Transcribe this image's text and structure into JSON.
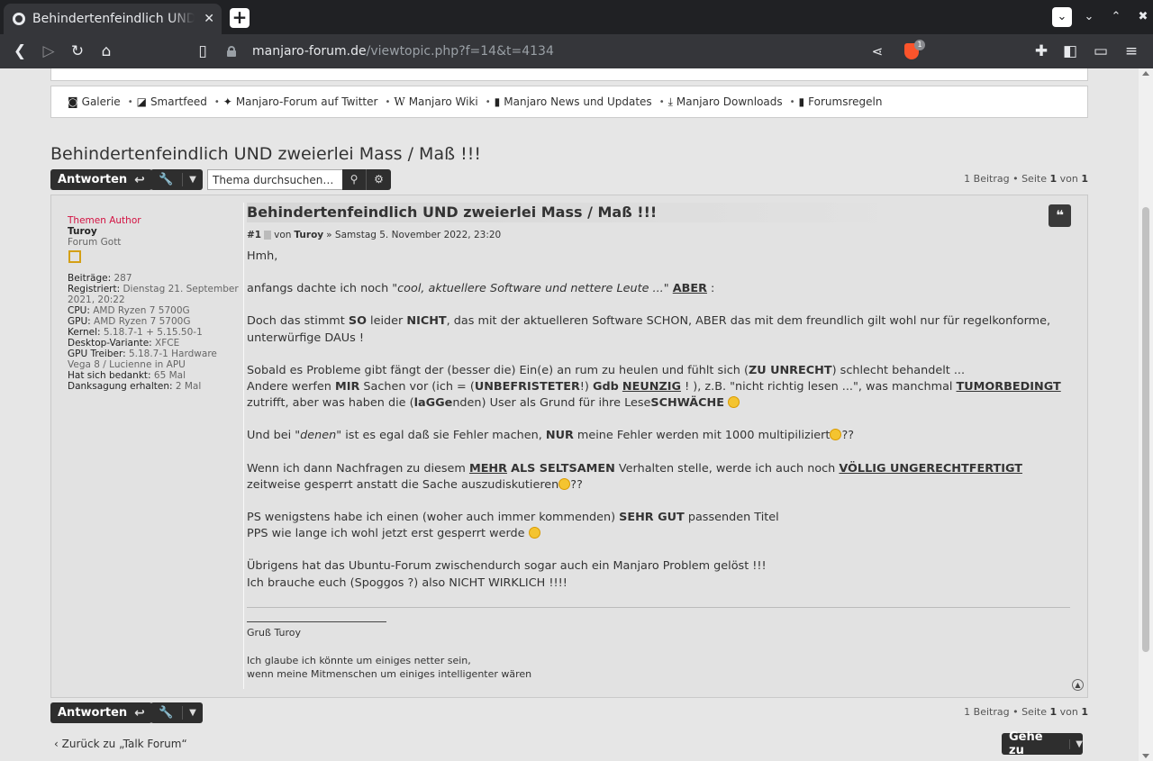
{
  "browser": {
    "tab_title": "Behindertenfeindlich UND zweierlei Mass / Maß !!!",
    "url_host": "manjaro-forum.de",
    "url_path": "/viewtopic.php?f=14&t=4134",
    "shield_count": "1"
  },
  "quicklinks": [
    {
      "icon": "camera-icon",
      "label": "Galerie"
    },
    {
      "icon": "rss-icon",
      "label": "Smartfeed"
    },
    {
      "icon": "twitter-icon",
      "label": "Manjaro-Forum auf Twitter"
    },
    {
      "icon": "wikipedia-icon",
      "label": "Manjaro Wiki"
    },
    {
      "icon": "book-icon",
      "label": "Manjaro News und Updates"
    },
    {
      "icon": "download-icon",
      "label": "Manjaro Downloads"
    },
    {
      "icon": "book-icon",
      "label": "Forumsregeln"
    }
  ],
  "topic": {
    "title": "Behindertenfeindlich UND zweierlei Mass / Maß !!!",
    "reply_label": "Antworten",
    "search_placeholder": "Thema durchsuchen…",
    "pagination": {
      "pre": "1 Beitrag • Seite ",
      "page": "1",
      "mid": " von ",
      "total": "1"
    }
  },
  "post": {
    "title": "Behindertenfeindlich UND zweierlei Mass / Maß !!!",
    "number": "#1",
    "by": "von",
    "author": "Turoy",
    "date": "» Samstag 5. November 2022, 23:20"
  },
  "profile": {
    "rank": "Themen Author",
    "name": "Turoy",
    "title": "Forum Gott",
    "fields": [
      {
        "k": "Beiträge:",
        "v": " 287"
      },
      {
        "k": "Registriert:",
        "v": " Dienstag 21. September 2021, 20:22"
      },
      {
        "k": "CPU:",
        "v": " AMD Ryzen 7 5700G"
      },
      {
        "k": "GPU:",
        "v": " AMD Ryzen 7 5700G"
      },
      {
        "k": "Kernel:",
        "v": " 5.18.7-1 + 5.15.50-1"
      },
      {
        "k": "Desktop-Variante:",
        "v": " XFCE"
      },
      {
        "k": "GPU Treiber:",
        "v": " 5.18.7-1 Hardware Vega 8 / Lucienne in APU"
      },
      {
        "k": "Hat sich bedankt:",
        "v": " 65 Mal"
      },
      {
        "k": "Danksagung erhalten:",
        "v": " 2 Mal"
      }
    ]
  },
  "content": {
    "p1": "Hmh,",
    "p2a": "anfangs dachte ich noch ",
    "p2b": "\"cool, aktuellere Software und nettere Leute ...\"",
    "p2c": " ",
    "p2d": "ABER",
    "p2e": " :",
    "p3a": "Doch das stimmt ",
    "p3b": "SO",
    "p3c": " leider ",
    "p3d": "NICHT",
    "p3e": ", das mit der aktuelleren Software SCHON, ABER das mit dem freundlich gilt wohl nur für regelkonforme, unterwürfige DAUs !",
    "p4a": "Sobald es Probleme gibt fängt der (besser die) Ein(e) an rum zu heulen und fühlt sich (",
    "p4b": "ZU UNRECHT",
    "p4c": ") schlecht behandelt ...",
    "p5a": "Andere werfen ",
    "p5b": "MIR",
    "p5c": " Sachen vor (ich = (",
    "p5d": "UNBEFRISTETER",
    "p5e": "!) ",
    "p5f": "Gdb",
    "p5g": " ",
    "p5h": "NEUNZIG",
    "p5i": " ! ), z.B. \"nicht richtig lesen ...\", was manchmal ",
    "p5j": "TUMORBEDINGT",
    "p5k": " zutrifft, aber was haben die (",
    "p5l": "laGGe",
    "p5m": "nden) User als Grund für ihre Lese",
    "p5n": "SCHWÄCHE",
    "p6a": "Und bei ",
    "p6b": "\"denen\"",
    "p6c": " ist es egal daß sie Fehler machen, ",
    "p6d": "NUR",
    "p6e": " meine Fehler werden mit 1000 multipiliziert",
    "p6f": "??",
    "p7a": "Wenn ich dann Nachfragen zu diesem ",
    "p7b": "MEHR",
    "p7c": " ",
    "p7d": "ALS SELTSAMEN",
    "p7e": " Verhalten stelle, werde ich auch noch ",
    "p7f": "VÖLLIG UNGERECHTFERTIGT",
    "p7g": " zeitweise gesperrt anstatt die Sache auszudiskutieren",
    "p7h": "??",
    "p8a": "PS wenigstens habe ich einen (woher auch immer kommenden) ",
    "p8b": "SEHR GUT",
    "p8c": " passenden Titel",
    "p9": "PPS wie lange ich wohl jetzt erst gesperrt werde",
    "p10": "Übrigens hat das Ubuntu-Forum zwischendurch sogar auch ein Manjaro Problem gelöst !!!",
    "p11": "Ich brauche euch (Spoggos ?) also NICHT WIRKLICH !!!!"
  },
  "signature": {
    "greeting": "Gruß Turoy",
    "line1": "Ich glaube ich könnte um einiges netter sein,",
    "line2": "wenn meine Mitmenschen um einiges intelligenter wären"
  },
  "footer": {
    "back_label": "Zurück zu „Talk Forum“",
    "goto_label": "Gehe zu"
  }
}
